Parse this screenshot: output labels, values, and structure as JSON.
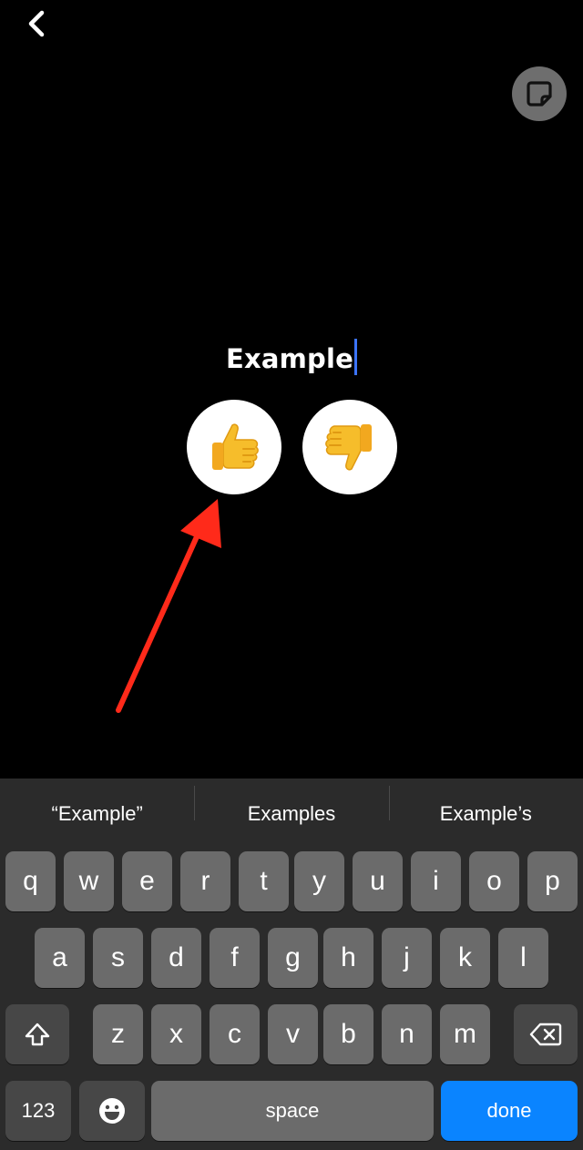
{
  "header": {
    "back_icon": "chevron-left-icon",
    "sticker_icon": "sticker-icon"
  },
  "poll": {
    "title": "Example",
    "options": [
      {
        "emoji": "👍",
        "name": "thumbs-up"
      },
      {
        "emoji": "👎",
        "name": "thumbs-down"
      }
    ],
    "annotation_color": "#ff2a1a"
  },
  "keyboard": {
    "suggestions": [
      "“Example”",
      "Examples",
      "Example’s"
    ],
    "row1": [
      "q",
      "w",
      "e",
      "r",
      "t",
      "y",
      "u",
      "i",
      "o",
      "p"
    ],
    "row2": [
      "a",
      "s",
      "d",
      "f",
      "g",
      "h",
      "j",
      "k",
      "l"
    ],
    "row3": [
      "z",
      "x",
      "c",
      "v",
      "b",
      "n",
      "m"
    ],
    "numbers_label": "123",
    "space_label": "space",
    "done_label": "done",
    "done_color": "#0a84ff"
  }
}
